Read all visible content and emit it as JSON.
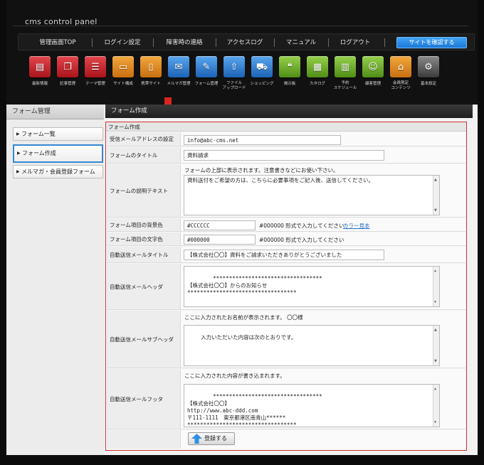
{
  "app": {
    "title": "cms control panel"
  },
  "top_menu": [
    "管理画面TOP",
    "ログイン設定",
    "障害時の連絡",
    "アクセスログ",
    "マニュアル",
    "ログアウト"
  ],
  "site_button": "サイトを確認する",
  "tools": [
    {
      "label": "最新情報",
      "icon": "newspaper-icon",
      "color": "#c9232a"
    },
    {
      "label": "記事管理",
      "icon": "articles-icon",
      "color": "#c9232a"
    },
    {
      "label": "テーマ管理",
      "icon": "list-icon",
      "color": "#c9232a"
    },
    {
      "label": "サイト構成",
      "icon": "monitor-icon",
      "color": "#e08a1e"
    },
    {
      "label": "携帯サイト",
      "icon": "mobile-icon",
      "color": "#e08a1e"
    },
    {
      "label": "メルマガ管理",
      "icon": "mail-icon",
      "color": "#2e7fd0"
    },
    {
      "label": "フォーム管理",
      "icon": "form-icon",
      "color": "#2e7fd0"
    },
    {
      "label": "ファイル\nアップロード",
      "icon": "file-upload-icon",
      "color": "#2e7fd0"
    },
    {
      "label": "ショッピング",
      "icon": "cart-icon",
      "color": "#2e7fd0"
    },
    {
      "label": "掲示板",
      "icon": "chat-icon",
      "color": "#6fb02b"
    },
    {
      "label": "カタログ",
      "icon": "catalog-icon",
      "color": "#6fb02b"
    },
    {
      "label": "予約\nスケジュール",
      "icon": "calendar-icon",
      "color": "#6fb02b"
    },
    {
      "label": "顧客管理",
      "icon": "customers-icon",
      "color": "#6fb02b"
    },
    {
      "label": "会員限定\nコンテンツ",
      "icon": "lock-icon",
      "color": "#e08a1e"
    },
    {
      "label": "基本設定",
      "icon": "gear-icon",
      "color": "#555555"
    }
  ],
  "sidebar": {
    "title": "フォーム管理",
    "items": [
      "フォーム一覧",
      "フォーム作成",
      "メルマガ・会員登録フォーム"
    ]
  },
  "main": {
    "title": "フォーム作成"
  },
  "form": {
    "title": "フォーム作成",
    "email": {
      "label": "受信メールアドレスの設定",
      "value": "info@abc-cms.net"
    },
    "form_title": {
      "label": "フォームのタイトル",
      "value": "資料請求"
    },
    "description": {
      "label": "フォームの説明テキスト",
      "hint": "フォームの上部に表示されます。注意書きなどにお使い下さい。",
      "value": "資料送付をご希望の方は、こちらに必要事項をご記入後、送信してください。"
    },
    "bg_color": {
      "label": "フォーム項目の背景色",
      "value": "#CCCCCC",
      "format_note": "#000000 形式で入力してください",
      "link": "カラー見本"
    },
    "text_color": {
      "label": "フォーム項目の文字色",
      "value": "#000000",
      "format_note": "#000000 形式で入力してください"
    },
    "auto_title": {
      "label": "自動送信メールタイトル",
      "value": "【株式会社〇〇】資料をご請求いただきありがとうございました"
    },
    "auto_header": {
      "label": "自動送信メールヘッダ",
      "value": "**********************************\n【株式会社〇〇】からのお知らせ\n**********************************"
    },
    "auto_subheader": {
      "label": "自動送信メールサブヘッダ",
      "hint": "ここに入力されたお名前が表示されます。 〇〇様",
      "value": "入力いただいた内容は次のとおりです。"
    },
    "auto_footer": {
      "label": "自動送信メールフッタ",
      "hint": "ここに入力された内容が書き込まれます。",
      "value": "**********************************\n【株式会社〇〇】\nhttp://www.abc-ddd.com\n〒111-1111　東京都港区南青山******\n**********************************"
    },
    "submit": "登録する"
  }
}
